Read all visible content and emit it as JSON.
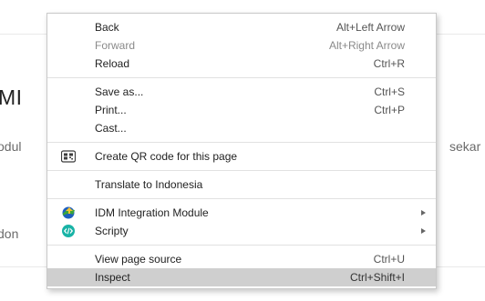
{
  "background": {
    "heading_fragment": "MI",
    "text_left_1": "odul",
    "text_right_1": "sekar",
    "text_left_2": "don"
  },
  "context_menu": {
    "items": [
      {
        "label": "Back",
        "shortcut": "Alt+Left Arrow"
      },
      {
        "label": "Forward",
        "shortcut": "Alt+Right Arrow",
        "disabled": true
      },
      {
        "label": "Reload",
        "shortcut": "Ctrl+R"
      },
      {
        "label": "Save as...",
        "shortcut": "Ctrl+S"
      },
      {
        "label": "Print...",
        "shortcut": "Ctrl+P"
      },
      {
        "label": "Cast...",
        "shortcut": ""
      },
      {
        "label": "Create QR code for this page",
        "icon": "qr-code-icon"
      },
      {
        "label": "Translate to Indonesia"
      },
      {
        "label": "IDM Integration Module",
        "icon": "idm-icon",
        "submenu": true
      },
      {
        "label": "Scripty",
        "icon": "scripty-icon",
        "submenu": true
      },
      {
        "label": "View page source",
        "shortcut": "Ctrl+U"
      },
      {
        "label": "Inspect",
        "shortcut": "Ctrl+Shift+I",
        "highlighted": true
      }
    ]
  },
  "colors": {
    "menu_background": "#ffffff",
    "highlight": "#cfcfcf",
    "disabled_text": "#8a8a8a",
    "idm_blue": "#1e5fbf",
    "idm_green": "#3aa63a",
    "scripty_teal": "#19b3a6"
  }
}
